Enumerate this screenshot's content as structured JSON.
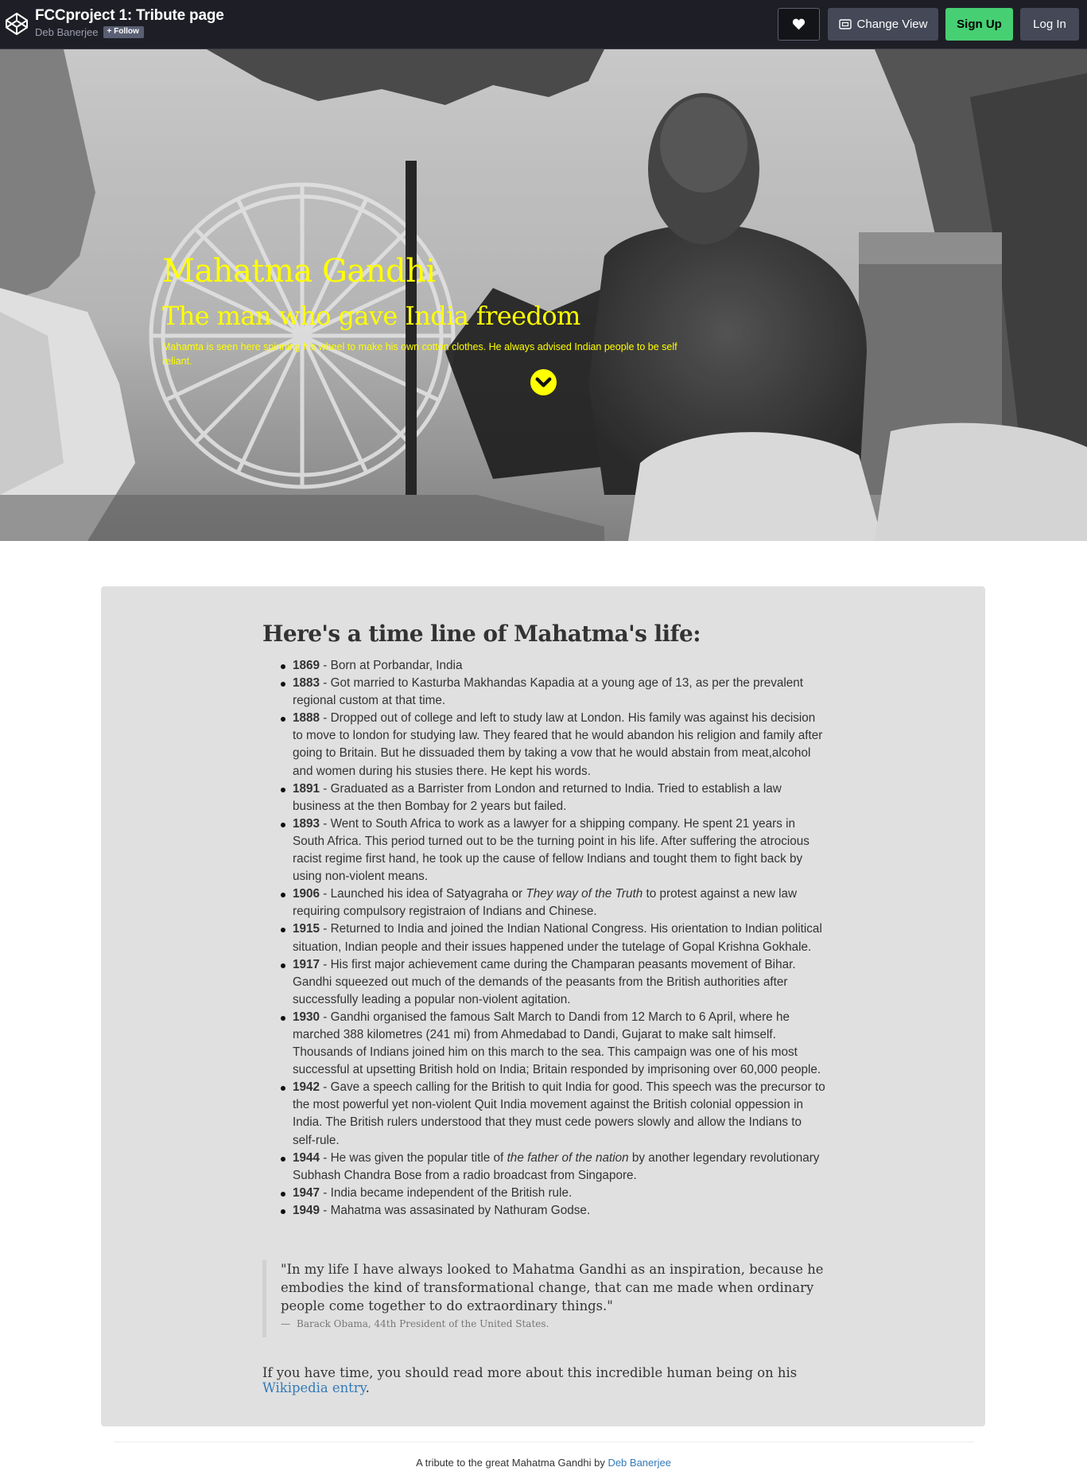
{
  "header": {
    "title": "FCCproject 1: Tribute page",
    "author": "Deb Banerjee",
    "follow_label": "Follow",
    "change_view_label": "Change View",
    "signup_label": "Sign Up",
    "login_label": "Log In",
    "icons": [
      "codepen-logo-icon",
      "plus-icon",
      "heart-icon",
      "layout-view-icon"
    ]
  },
  "hero": {
    "title": "Mahatma Gandhi",
    "subtitle": "The man who gave India freedom",
    "caption": "Mahamta is seen here spinning his wheel to make his own cotton clothes. He always advised Indian people to be self reliant.",
    "scroll_icon": "chevron-down-circle-icon",
    "text_color": "#ffff00"
  },
  "timeline": {
    "heading": "Here's a time line of Mahatma's life:",
    "items": [
      {
        "year": "1869",
        "parts": [
          {
            "text": " - Born at Porbandar, India"
          }
        ]
      },
      {
        "year": "1883",
        "parts": [
          {
            "text": " - Got married to Kasturba Makhandas Kapadia at a young age of 13, as per the prevalent regional custom at that time."
          }
        ]
      },
      {
        "year": "1888",
        "parts": [
          {
            "text": " - Dropped out of college and left to study law at London. His family was against his decision to move to london for studying law. They feared that he would abandon his religion and family after going to Britain. But he dissuaded them by taking a vow that he would abstain from meat,alcohol and women during his stusies there. He kept his words."
          }
        ]
      },
      {
        "year": "1891",
        "parts": [
          {
            "text": " - Graduated as a Barrister from London and returned to India. Tried to establish a law business at the then Bombay for 2 years but failed."
          }
        ]
      },
      {
        "year": "1893",
        "parts": [
          {
            "text": " - Went to South Africa to work as a lawyer for a shipping company. He spent 21 years in South Africa. This period turned out to be the turning point in his life. After suffering the atrocious racist regime first hand, he took up the cause of fellow Indians and tought them to fight back by using non-violent means."
          }
        ]
      },
      {
        "year": "1906",
        "parts": [
          {
            "text": " - Launched his idea of Satyagraha or "
          },
          {
            "text": "They way of the Truth",
            "em": true
          },
          {
            "text": " to protest against a new law requiring compulsory registraion of Indians and Chinese."
          }
        ]
      },
      {
        "year": "1915",
        "parts": [
          {
            "text": " - Returned to India and joined the Indian National Congress. His orientation to Indian political situation, Indian people and their issues happened under the tutelage of Gopal Krishna Gokhale."
          }
        ]
      },
      {
        "year": "1917",
        "parts": [
          {
            "text": " - His first major achievement came during the Champaran peasants movement of Bihar. Gandhi squeezed out much of the demands of the peasants from the British authorities after successfully leading a popular non-violent agitation."
          }
        ]
      },
      {
        "year": "1930",
        "parts": [
          {
            "text": " - Gandhi organised the famous Salt March to Dandi from 12 March to 6 April, where he marched 388 kilometres (241 mi) from Ahmedabad to Dandi, Gujarat to make salt himself. Thousands of Indians joined him on this march to the sea. This campaign was one of his most successful at upsetting British hold on India; Britain responded by imprisoning over 60,000 people."
          }
        ]
      },
      {
        "year": "1942",
        "parts": [
          {
            "text": " - Gave a speech calling for the British to quit India for good. This speech was the precursor to the most powerful yet non-violent Quit India movement against the British colonial oppession in India. The British rulers understood that they must cede powers slowly and allow the Indians to self-rule."
          }
        ]
      },
      {
        "year": "1944",
        "parts": [
          {
            "text": " - He was given the popular title of "
          },
          {
            "text": "the father of the nation",
            "em": true
          },
          {
            "text": " by another legendary revolutionary Subhash Chandra Bose from a radio broadcast from Singapore."
          }
        ]
      },
      {
        "year": "1947",
        "parts": [
          {
            "text": " - India became independent of the British rule."
          }
        ]
      },
      {
        "year": "1949",
        "parts": [
          {
            "text": " - Mahatma was assasinated by Nathuram Godse."
          }
        ]
      }
    ]
  },
  "quote": {
    "text": "\"In my life I have always looked to Mahatma Gandhi as an inspiration, because he embodies the kind of transformational change, that can me made when ordinary people come together to do extraordinary things.\"",
    "dash": "—",
    "cite": "Barack Obama, 44th President of the United States."
  },
  "more_info": {
    "text": "If you have time, you should read more about this incredible human being on his ",
    "link_label": "Wikipedia entry",
    "suffix": "."
  },
  "footer": {
    "text": "A tribute to the great Mahatma Gandhi by ",
    "link_label": "Deb Banerjee"
  },
  "colors": {
    "topbar": "#1e1f26",
    "signup": "#47cf73",
    "card": "#e0e0e0",
    "link": "#337ab7"
  }
}
